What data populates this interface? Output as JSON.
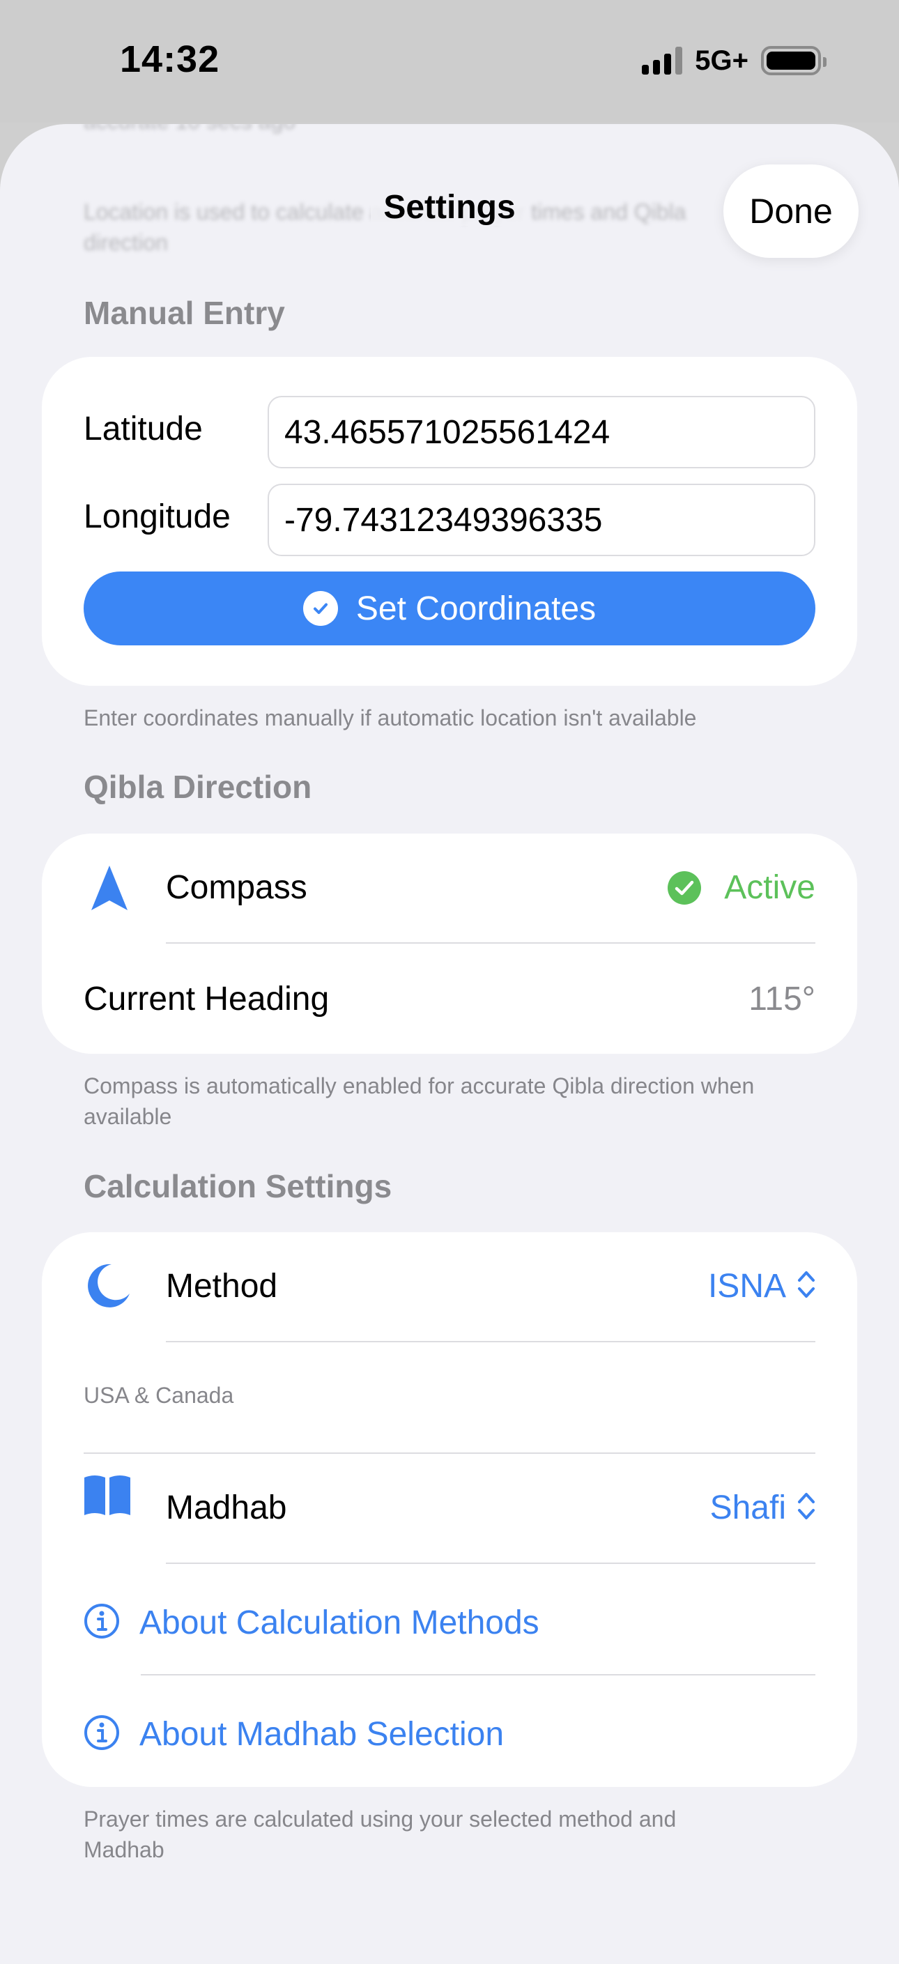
{
  "status_bar": {
    "time": "14:32",
    "network": "5G+",
    "battery_icon": "battery-full-icon",
    "signal_icon": "cellular-signal-icon"
  },
  "sheet": {
    "ghost_text_1": "accurate 10 secs ago",
    "ghost_text_2": "Location is used to calculate accurate prayer times and Qibla direction",
    "title": "Settings",
    "done_label": "Done"
  },
  "manual_entry": {
    "header": "Manual Entry",
    "latitude_label": "Latitude",
    "latitude_value": "43.465571025561424",
    "longitude_label": "Longitude",
    "longitude_value": "-79.74312349396335",
    "set_button_label": "Set Coordinates",
    "footnote": "Enter coordinates manually if automatic location isn't available"
  },
  "qibla": {
    "header": "Qibla Direction",
    "compass_label": "Compass",
    "compass_status": "Active",
    "heading_label": "Current Heading",
    "heading_value": "115°",
    "footnote": "Compass is automatically enabled for accurate Qibla direction when available"
  },
  "calculation": {
    "header": "Calculation Settings",
    "method_label": "Method",
    "method_value": "ISNA",
    "method_subtitle": "USA & Canada",
    "madhab_label": "Madhab",
    "madhab_value": "Shafi",
    "about_methods": "About Calculation Methods",
    "about_madhab": "About Madhab Selection",
    "footnote": "Prayer times are calculated using your selected method and Madhab"
  },
  "colors": {
    "accent": "#3b86f5",
    "success": "#5cc15a",
    "background": "#f1f1f6",
    "secondary_text": "#86868b"
  }
}
